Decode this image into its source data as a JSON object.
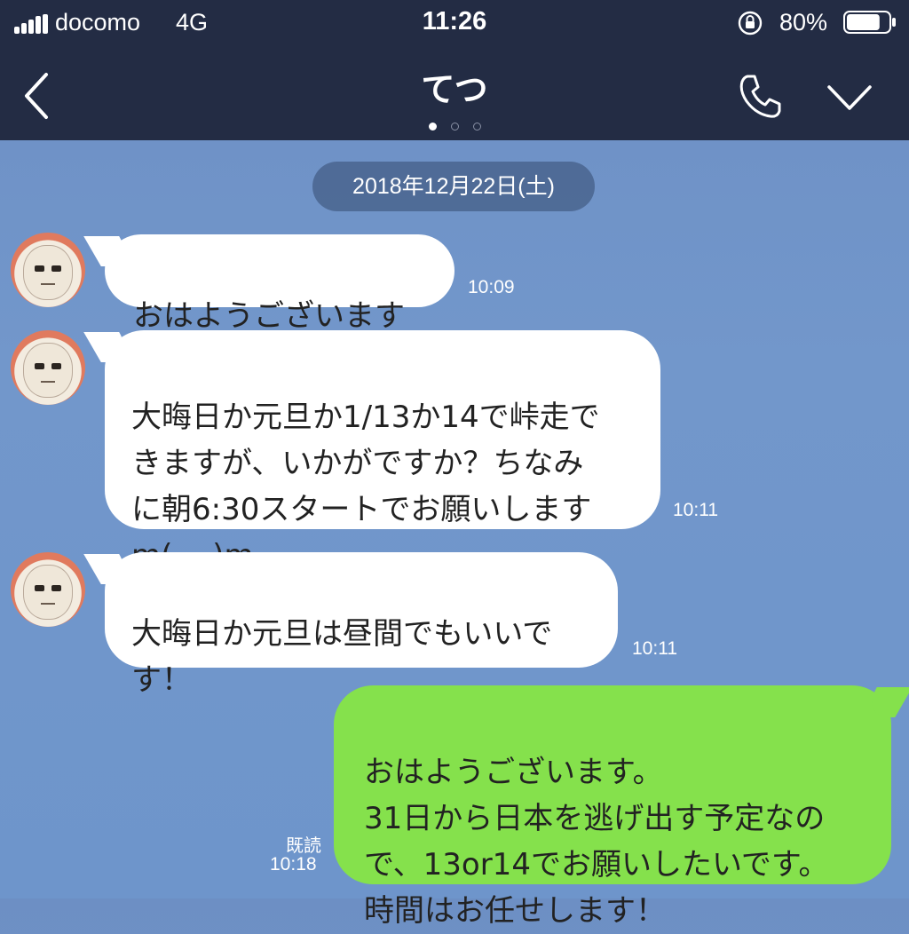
{
  "status_bar": {
    "carrier": "docomo",
    "network": "4G",
    "time": "11:26",
    "battery_percent": "80%",
    "battery_level": 0.8,
    "orientation_lock_icon": "orientation-lock-icon"
  },
  "header": {
    "title": "てつ",
    "back_icon": "chevron-left-icon",
    "call_icon": "phone-icon",
    "menu_icon": "chevron-down-icon",
    "page_dots": 3,
    "active_dot": 0
  },
  "chat": {
    "date_separator": "2018年12月22日(土)",
    "messages": [
      {
        "side": "in",
        "text": "おはようございます",
        "time": "10:09"
      },
      {
        "side": "in",
        "text": "大晦日か元旦か1/13か14で峠走で\nきますが、いかがですか？ちなみ\nに朝6:30スタートでお願いします\nm(_ _)m",
        "time": "10:11"
      },
      {
        "side": "in",
        "text": "大晦日か元旦は昼間でもいいで\nす！",
        "time": "10:11"
      },
      {
        "side": "out",
        "text": "おはようございます。\n31日から日本を逃げ出す予定なの\nで、13or14でお願いしたいです。\n時間はお任せします！",
        "read": "既読",
        "time": "10:18"
      }
    ]
  },
  "colors": {
    "header_bg": "#232c44",
    "chat_bg": "#7297cb",
    "incoming_bubble": "#ffffff",
    "outgoing_bubble": "#85e14c"
  }
}
